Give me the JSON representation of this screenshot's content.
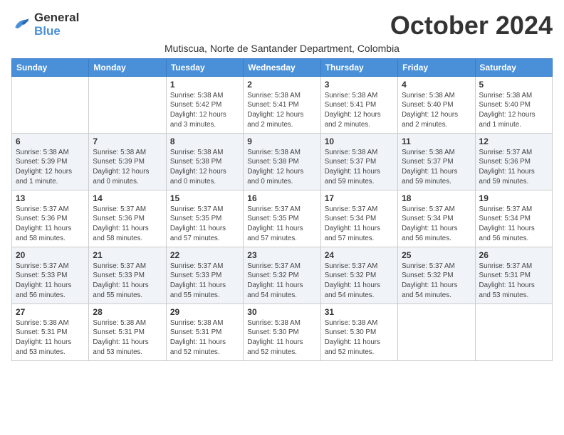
{
  "logo": {
    "line1": "General",
    "line2": "Blue"
  },
  "title": "October 2024",
  "subtitle": "Mutiscua, Norte de Santander Department, Colombia",
  "weekdays": [
    "Sunday",
    "Monday",
    "Tuesday",
    "Wednesday",
    "Thursday",
    "Friday",
    "Saturday"
  ],
  "weeks": [
    [
      {
        "day": "",
        "detail": ""
      },
      {
        "day": "",
        "detail": ""
      },
      {
        "day": "1",
        "detail": "Sunrise: 5:38 AM\nSunset: 5:42 PM\nDaylight: 12 hours\nand 3 minutes."
      },
      {
        "day": "2",
        "detail": "Sunrise: 5:38 AM\nSunset: 5:41 PM\nDaylight: 12 hours\nand 2 minutes."
      },
      {
        "day": "3",
        "detail": "Sunrise: 5:38 AM\nSunset: 5:41 PM\nDaylight: 12 hours\nand 2 minutes."
      },
      {
        "day": "4",
        "detail": "Sunrise: 5:38 AM\nSunset: 5:40 PM\nDaylight: 12 hours\nand 2 minutes."
      },
      {
        "day": "5",
        "detail": "Sunrise: 5:38 AM\nSunset: 5:40 PM\nDaylight: 12 hours\nand 1 minute."
      }
    ],
    [
      {
        "day": "6",
        "detail": "Sunrise: 5:38 AM\nSunset: 5:39 PM\nDaylight: 12 hours\nand 1 minute."
      },
      {
        "day": "7",
        "detail": "Sunrise: 5:38 AM\nSunset: 5:39 PM\nDaylight: 12 hours\nand 0 minutes."
      },
      {
        "day": "8",
        "detail": "Sunrise: 5:38 AM\nSunset: 5:38 PM\nDaylight: 12 hours\nand 0 minutes."
      },
      {
        "day": "9",
        "detail": "Sunrise: 5:38 AM\nSunset: 5:38 PM\nDaylight: 12 hours\nand 0 minutes."
      },
      {
        "day": "10",
        "detail": "Sunrise: 5:38 AM\nSunset: 5:37 PM\nDaylight: 11 hours\nand 59 minutes."
      },
      {
        "day": "11",
        "detail": "Sunrise: 5:38 AM\nSunset: 5:37 PM\nDaylight: 11 hours\nand 59 minutes."
      },
      {
        "day": "12",
        "detail": "Sunrise: 5:37 AM\nSunset: 5:36 PM\nDaylight: 11 hours\nand 59 minutes."
      }
    ],
    [
      {
        "day": "13",
        "detail": "Sunrise: 5:37 AM\nSunset: 5:36 PM\nDaylight: 11 hours\nand 58 minutes."
      },
      {
        "day": "14",
        "detail": "Sunrise: 5:37 AM\nSunset: 5:36 PM\nDaylight: 11 hours\nand 58 minutes."
      },
      {
        "day": "15",
        "detail": "Sunrise: 5:37 AM\nSunset: 5:35 PM\nDaylight: 11 hours\nand 57 minutes."
      },
      {
        "day": "16",
        "detail": "Sunrise: 5:37 AM\nSunset: 5:35 PM\nDaylight: 11 hours\nand 57 minutes."
      },
      {
        "day": "17",
        "detail": "Sunrise: 5:37 AM\nSunset: 5:34 PM\nDaylight: 11 hours\nand 57 minutes."
      },
      {
        "day": "18",
        "detail": "Sunrise: 5:37 AM\nSunset: 5:34 PM\nDaylight: 11 hours\nand 56 minutes."
      },
      {
        "day": "19",
        "detail": "Sunrise: 5:37 AM\nSunset: 5:34 PM\nDaylight: 11 hours\nand 56 minutes."
      }
    ],
    [
      {
        "day": "20",
        "detail": "Sunrise: 5:37 AM\nSunset: 5:33 PM\nDaylight: 11 hours\nand 56 minutes."
      },
      {
        "day": "21",
        "detail": "Sunrise: 5:37 AM\nSunset: 5:33 PM\nDaylight: 11 hours\nand 55 minutes."
      },
      {
        "day": "22",
        "detail": "Sunrise: 5:37 AM\nSunset: 5:33 PM\nDaylight: 11 hours\nand 55 minutes."
      },
      {
        "day": "23",
        "detail": "Sunrise: 5:37 AM\nSunset: 5:32 PM\nDaylight: 11 hours\nand 54 minutes."
      },
      {
        "day": "24",
        "detail": "Sunrise: 5:37 AM\nSunset: 5:32 PM\nDaylight: 11 hours\nand 54 minutes."
      },
      {
        "day": "25",
        "detail": "Sunrise: 5:37 AM\nSunset: 5:32 PM\nDaylight: 11 hours\nand 54 minutes."
      },
      {
        "day": "26",
        "detail": "Sunrise: 5:37 AM\nSunset: 5:31 PM\nDaylight: 11 hours\nand 53 minutes."
      }
    ],
    [
      {
        "day": "27",
        "detail": "Sunrise: 5:38 AM\nSunset: 5:31 PM\nDaylight: 11 hours\nand 53 minutes."
      },
      {
        "day": "28",
        "detail": "Sunrise: 5:38 AM\nSunset: 5:31 PM\nDaylight: 11 hours\nand 53 minutes."
      },
      {
        "day": "29",
        "detail": "Sunrise: 5:38 AM\nSunset: 5:31 PM\nDaylight: 11 hours\nand 52 minutes."
      },
      {
        "day": "30",
        "detail": "Sunrise: 5:38 AM\nSunset: 5:30 PM\nDaylight: 11 hours\nand 52 minutes."
      },
      {
        "day": "31",
        "detail": "Sunrise: 5:38 AM\nSunset: 5:30 PM\nDaylight: 11 hours\nand 52 minutes."
      },
      {
        "day": "",
        "detail": ""
      },
      {
        "day": "",
        "detail": ""
      }
    ]
  ]
}
